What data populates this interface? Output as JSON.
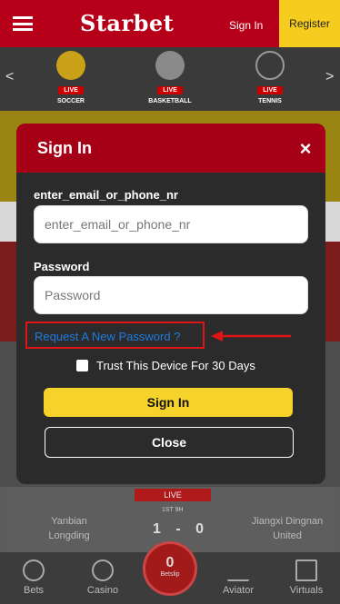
{
  "header": {
    "brand": "Starbet",
    "sign_in": "Sign In",
    "register": "Register"
  },
  "sports": [
    {
      "name": "SOCCER",
      "badge": "LIVE",
      "icon": "soccer-ball-icon"
    },
    {
      "name": "BASKETBALL",
      "badge": "LIVE",
      "icon": "basketball-icon"
    },
    {
      "name": "TENNIS",
      "badge": "LIVE",
      "icon": "tennis-racket-icon"
    }
  ],
  "match": {
    "status": "LIVE",
    "time": "1ST 9H",
    "home": "Yanbian Longding",
    "away": "Jiangxi Dingnan United",
    "score": "1 - 0"
  },
  "bottom_nav": {
    "bets": "Bets",
    "casino": "Casino",
    "betslip_count": "0",
    "betslip": "Betslip",
    "aviator": "Aviator",
    "virtuals": "Virtuals"
  },
  "modal": {
    "title": "Sign In",
    "close_icon": "×",
    "email_label": "enter_email_or_phone_nr",
    "email_placeholder": "enter_email_or_phone_nr",
    "email_value": "",
    "password_label": "Password",
    "password_placeholder": "Password",
    "password_value": "",
    "forgot_link": "Request A New Password ?",
    "trust_label": "Trust This Device For 30 Days",
    "trust_checked": false,
    "signin_button": "Sign In",
    "close_button": "Close"
  },
  "colors": {
    "brand_red": "#a50016",
    "accent_yellow": "#f6d32a",
    "link_blue": "#1e7be0",
    "highlight_red": "#e01414"
  }
}
